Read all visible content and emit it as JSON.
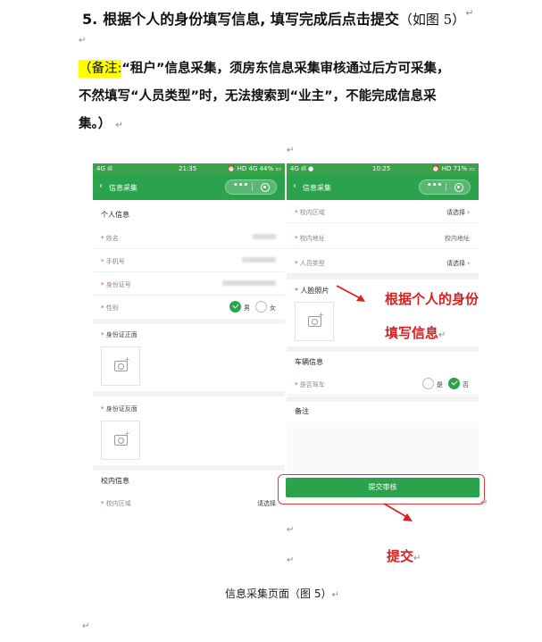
{
  "heading": {
    "num": "5.",
    "text": "根据个人的身份填写信息, 填写完成后点击提交",
    "paren": "（如图 5）"
  },
  "note": {
    "prefix": "（备注:",
    "line1_rest": "“租户”信息采集，须房东信息采集审核通过后方可采集，",
    "line2": "不然填写“人员类型”时，无法搜索到“业主”，不能完成信息采",
    "line3": "集。）"
  },
  "left_phone": {
    "status": {
      "net": "4G ıll",
      "time": "21:35",
      "right": "⏰ HD 4G 44% ▭"
    },
    "nav_title": "信息采集",
    "section_personal": "个人信息",
    "name_label": "姓名",
    "phone_label": "手机号",
    "id_label": "身份证号",
    "gender_label": "性别",
    "gender_male": "男",
    "gender_female": "女",
    "id_front": "身份证正面",
    "id_back": "身份证反面",
    "section_campus": "校内信息",
    "campus_area_label": "校内区域",
    "campus_area_value": "请选择"
  },
  "right_phone": {
    "status": {
      "net": "4G ıll ●",
      "time": "10:25",
      "right": "⏰ HD 71% ▭"
    },
    "nav_title": "信息采集",
    "campus_area_label": "校内区域",
    "campus_area_value": "请选择",
    "campus_addr_label": "校内地址",
    "campus_addr_value": "校内地址",
    "person_type_label": "人员类型",
    "person_type_value": "请选择",
    "face_photo": "人脸照片",
    "section_vehicle": "车辆信息",
    "has_car_label": "是否驾车",
    "yes": "是",
    "no": "否",
    "remark": "备注",
    "submit": "提交审核"
  },
  "annotation_fill_1": "根据个人的身份",
  "annotation_fill_2": "填写信息",
  "annotation_submit": "提交",
  "caption": "信息采集页面（图 5）",
  "colors": {
    "green": "#2ba24c",
    "highlight": "#ffff00",
    "red": "#d62222"
  }
}
